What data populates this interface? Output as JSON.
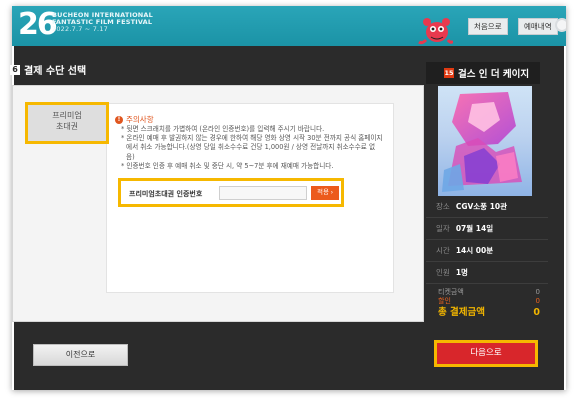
{
  "header": {
    "logo_number": "26",
    "logo_line1": "BUCHEON INTERNATIONAL",
    "logo_line2": "FANTASTIC FILM FESTIVAL",
    "logo_dates": "2022.7.7 ~ 7.17",
    "home_label": "처음으로",
    "history_label": "예매내역",
    "brand_color": "#1b93a6"
  },
  "section": {
    "step_number": "6",
    "title": "결제 수단 선택"
  },
  "sidebar": {
    "tab_line1": "프리미엄",
    "tab_line2": "초대권"
  },
  "notice": {
    "title": "주의사항",
    "items": [
      "* 뒷면 스크래치를 가볍하여 (온라인 인증번호)를 입력해 주시기 바랍니다.",
      "* 온라인 예매 후 발권하지 않는 경우에 한하여 해당 영화 상영 시작 30분 전까지 공식 홈페이지에서 취소 가능합니다.(상영 당일 취소수수료 건당 1,000원 / 상영 전날까지 취소수수료 없음)",
      "* 인증번호 인증 후 예매 취소 및 중단 시, 약 5~7분 후에 재예매 가능합니다."
    ]
  },
  "auth": {
    "label": "프리미엄초대권 인증번호",
    "input_value": "",
    "apply_label": "적용 ›"
  },
  "movie": {
    "rating": "15",
    "title": "걸스 인 더 케이지",
    "info": [
      {
        "key": "장소",
        "value": "CGV소풍 10관"
      },
      {
        "key": "일자",
        "value": "07월 14일"
      },
      {
        "key": "시간",
        "value": "14시 00분"
      },
      {
        "key": "인원",
        "value": "1명"
      }
    ]
  },
  "price": {
    "ticket_label": "티켓금액",
    "ticket_value": "0",
    "discount_label": "할인",
    "discount_value": "0",
    "total_label": "총 결제금액",
    "total_value": "0"
  },
  "nav": {
    "prev_label": "이전으로",
    "next_label": "다음으로"
  }
}
